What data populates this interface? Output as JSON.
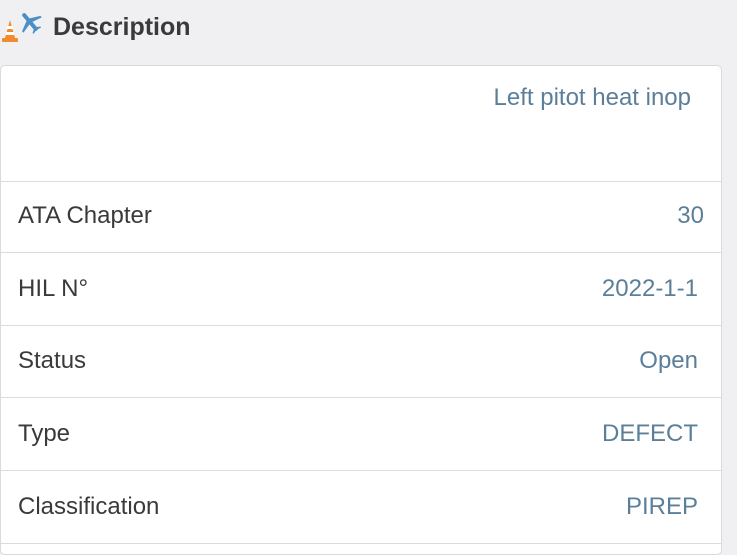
{
  "section": {
    "title": "Description",
    "icon": "cone-airplane-icon",
    "icon_colors": {
      "cone": "#f28b30",
      "plane": "#4a8fc8"
    }
  },
  "description": {
    "text": "Left pitot heat inop"
  },
  "rows": [
    {
      "label": "ATA Chapter",
      "value": "30"
    },
    {
      "label": "HIL N°",
      "value": "2022-1-1"
    },
    {
      "label": "Status",
      "value": "Open"
    },
    {
      "label": "Type",
      "value": "DEFECT"
    },
    {
      "label": "Classification",
      "value": "PIREP"
    }
  ],
  "colors": {
    "value_text": "#5b7f99",
    "label_text": "#3a3a3c",
    "background": "#f0f0f3"
  }
}
